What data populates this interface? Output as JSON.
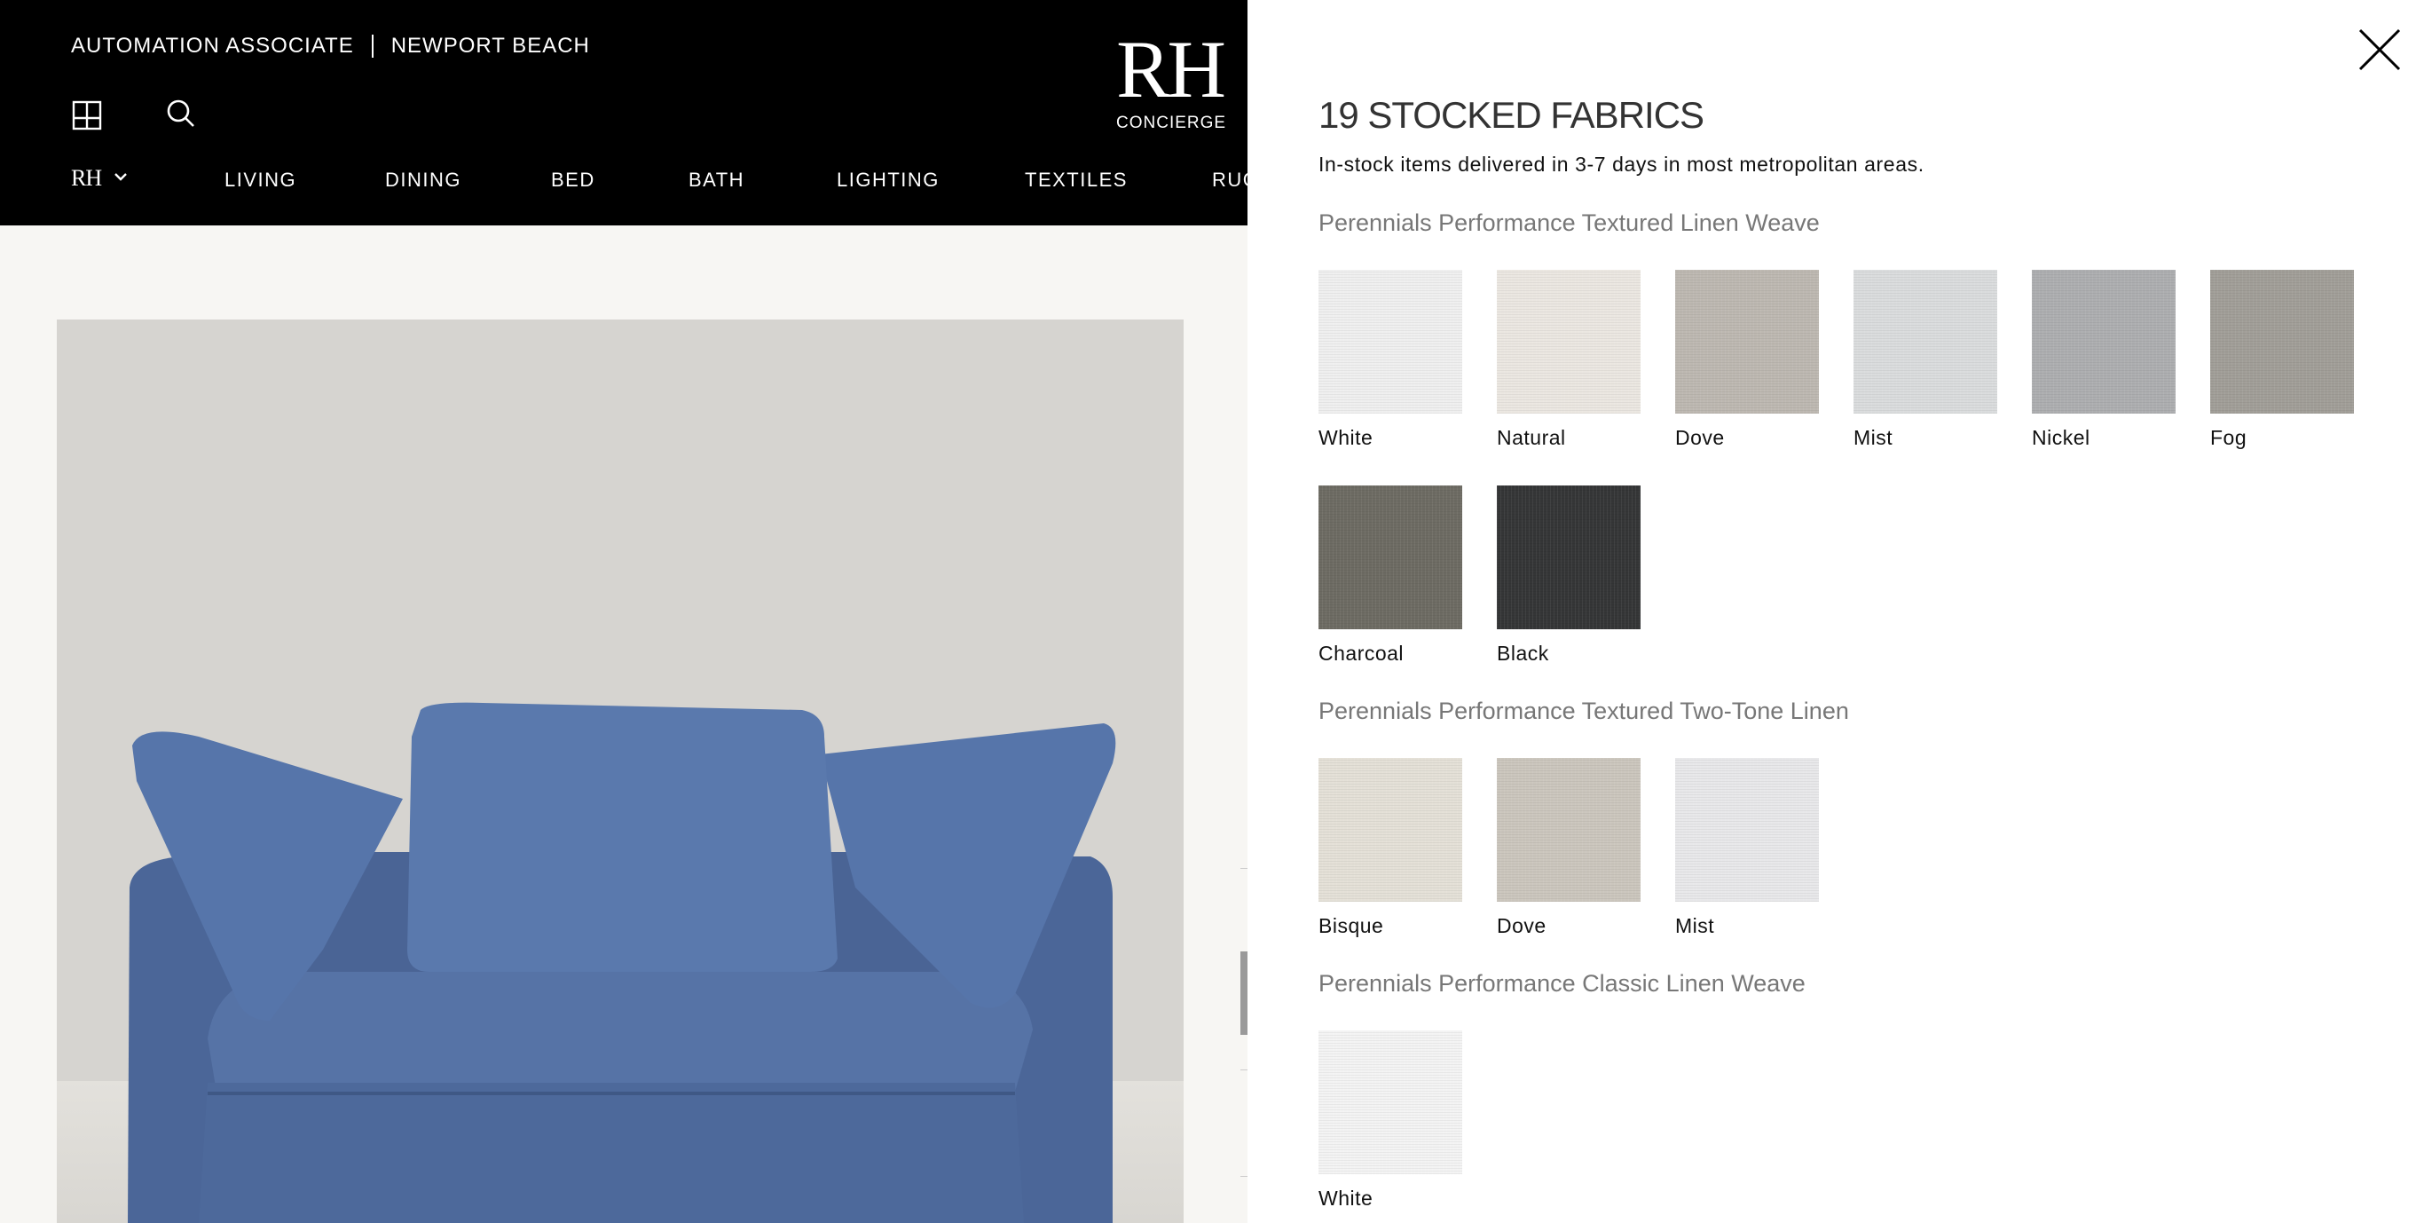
{
  "header": {
    "associate": "AUTOMATION ASSOCIATE",
    "location": "NEWPORT BEACH",
    "logo": "RH",
    "logo_sub": "CONCIERGE",
    "brand_menu": "RH",
    "nav": [
      "LIVING",
      "DINING",
      "BED",
      "BATH",
      "LIGHTING",
      "TEXTILES",
      "RUG"
    ]
  },
  "drawer": {
    "title": "19 STOCKED FABRICS",
    "subtitle": "In-stock items delivered in 3-7 days in most metropolitan areas.",
    "groups": [
      {
        "title": "Perennials Performance Textured Linen Weave",
        "swatches": [
          {
            "name": "White",
            "color": "#efefef"
          },
          {
            "name": "Natural",
            "color": "#ebe7e1"
          },
          {
            "name": "Dove",
            "color": "#bdb8b1"
          },
          {
            "name": "Mist",
            "color": "#dadcdd"
          },
          {
            "name": "Nickel",
            "color": "#adaeb0"
          },
          {
            "name": "Fog",
            "color": "#a19e98"
          },
          {
            "name": "Charcoal",
            "color": "#6d6b63"
          },
          {
            "name": "Black",
            "color": "#353637"
          }
        ]
      },
      {
        "title": "Perennials Performance Textured Two-Tone Linen",
        "swatches": [
          {
            "name": "Bisque",
            "color": "#e4e0d7"
          },
          {
            "name": "Dove",
            "color": "#cbc6bd"
          },
          {
            "name": "Mist",
            "color": "#e8e8ea"
          }
        ]
      },
      {
        "title": "Perennials Performance Classic Linen Weave",
        "swatches": [
          {
            "name": "White",
            "color": "#f3f3f3"
          }
        ]
      }
    ]
  },
  "colors": {
    "header_bg": "#000000",
    "sofa": "#4e6a9c",
    "drawer_bg": "#ffffff"
  }
}
